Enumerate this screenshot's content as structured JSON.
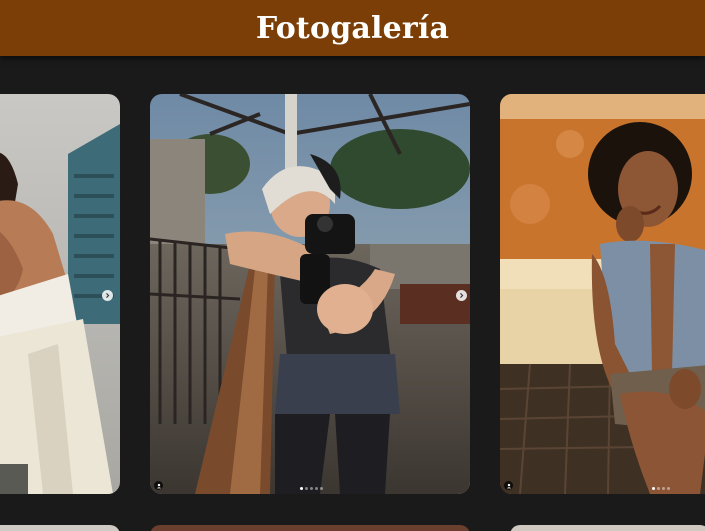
{
  "header": {
    "title": "Fotogalería",
    "background_color": "#7a3e06"
  },
  "gallery": {
    "posts": [
      {
        "position": "left-partial",
        "next_icon": "chevron-right-icon"
      },
      {
        "position": "center",
        "next_icon": "chevron-right-icon",
        "user_tag_icon": "person-icon",
        "carousel_total": 5,
        "carousel_active": 1
      },
      {
        "position": "right-partial",
        "user_tag_icon": "person-icon",
        "carousel_total": 4,
        "carousel_active": 1
      }
    ]
  },
  "colors": {
    "page_background": "#1a1a1a",
    "header_text": "#ffffff"
  }
}
